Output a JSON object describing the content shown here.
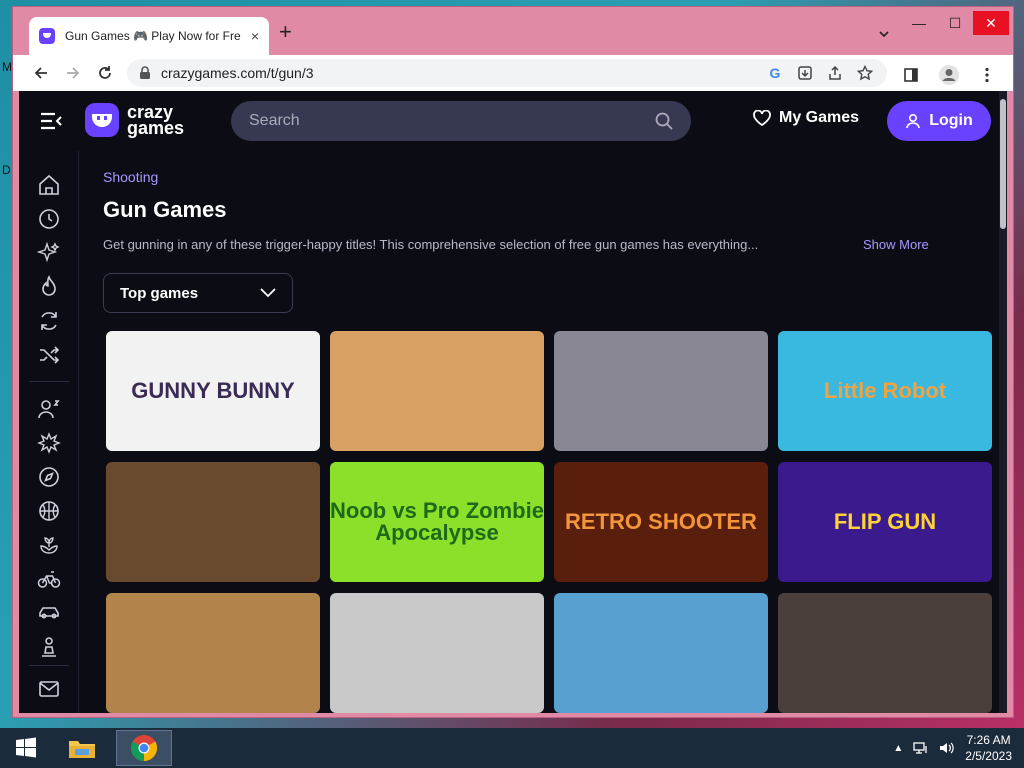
{
  "desktop": {
    "label_m": "M",
    "label_d": "D"
  },
  "browser": {
    "tab_title": "Gun Games 🎮 Play Now for Free",
    "tab_close": "×",
    "new_tab": "+",
    "minimize": "—",
    "maximize": "☐",
    "close": "✕",
    "url": "crazygames.com/t/gun/3"
  },
  "site": {
    "logo_line1": "crazy",
    "logo_line2": "games",
    "search_placeholder": "Search",
    "my_games": "My Games",
    "login": "Login",
    "breadcrumb": "Shooting",
    "title": "Gun Games",
    "description": "Get gunning in any of these trigger-happy titles! This comprehensive selection of free gun games has everything...",
    "show_more": "Show More",
    "sort_selected": "Top games"
  },
  "games": [
    {
      "label": "GUNNY BUNNY",
      "bg": "#f2f2f2",
      "fg": "#3a2a55"
    },
    {
      "label": "",
      "bg": "#d9a064",
      "fg": "#ffffff"
    },
    {
      "label": "",
      "bg": "#8a8794",
      "fg": "#ffffff"
    },
    {
      "label": "Little Robot",
      "bg": "#39b8e0",
      "fg": "#f2a341"
    },
    {
      "label": "",
      "bg": "#6a4a2e",
      "fg": "#ffffff"
    },
    {
      "label": "Noob vs Pro Zombie Apocalypse",
      "bg": "#8be02a",
      "fg": "#1f6a1a"
    },
    {
      "label": "RETRO SHOOTER",
      "bg": "#5a1e0c",
      "fg": "#f3953a"
    },
    {
      "label": "FLIP GUN",
      "bg": "#3a1a8c",
      "fg": "#ffd23a"
    },
    {
      "label": "",
      "bg": "#b0844a",
      "fg": "#ffffff"
    },
    {
      "label": "",
      "bg": "#c9c9c9",
      "fg": "#ffffff"
    },
    {
      "label": "",
      "bg": "#58a0d0",
      "fg": "#ffffff"
    },
    {
      "label": "",
      "bg": "#4a3f3a",
      "fg": "#ffffff"
    }
  ],
  "taskbar": {
    "time": "7:26 AM",
    "date": "2/5/2023"
  },
  "colors": {
    "accent": "#6842ff",
    "page_bg": "#0c0d14"
  }
}
